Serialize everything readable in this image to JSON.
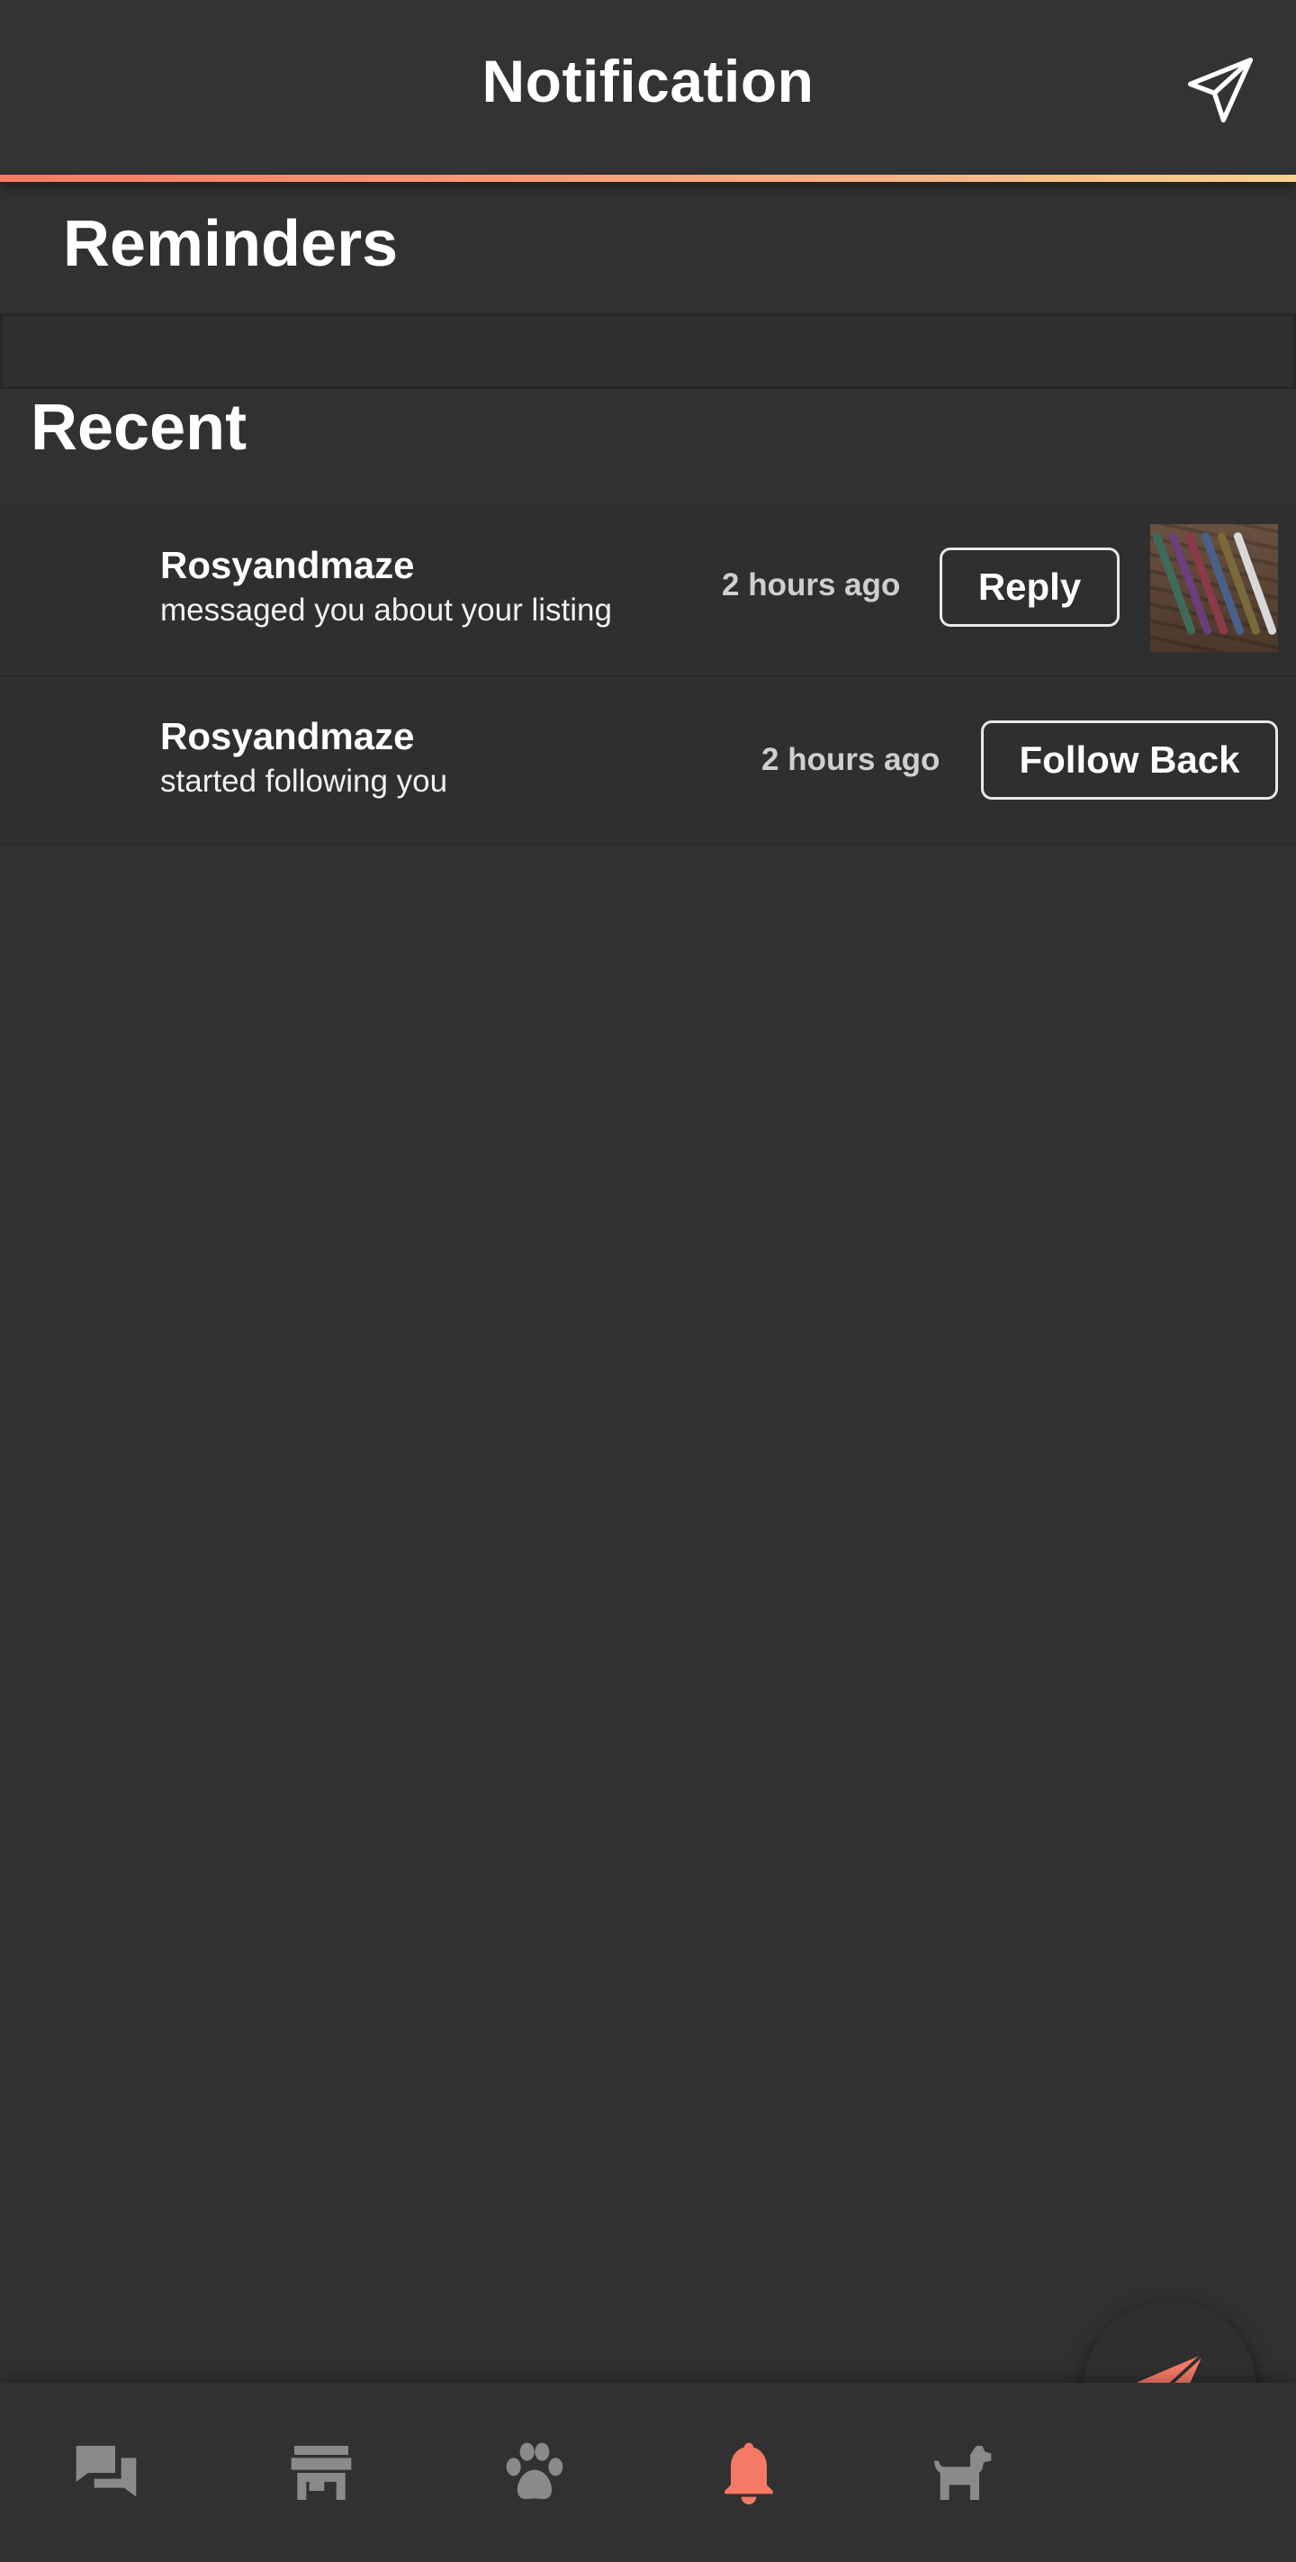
{
  "header": {
    "title": "Notification",
    "send_icon": "paper-plane-icon"
  },
  "reminders": {
    "title": "Reminders"
  },
  "recent": {
    "title": "Recent",
    "items": [
      {
        "name": "Rosyandmaze",
        "message": "messaged you about your listing",
        "time": "2 hours ago",
        "action": "Reply"
      },
      {
        "name": "Rosyandmaze",
        "message": "started following you",
        "time": "2 hours ago",
        "action": "Follow Back"
      }
    ]
  },
  "bottom_nav": {
    "items": [
      {
        "icon": "chat-icon",
        "active": false
      },
      {
        "icon": "store-icon",
        "active": false
      },
      {
        "icon": "paw-icon",
        "active": false
      },
      {
        "icon": "bell-icon",
        "active": true
      },
      {
        "icon": "dog-icon",
        "active": false
      }
    ],
    "fab_icon": "paper-plane-icon"
  },
  "colors": {
    "background": "#313131",
    "accent": "#f47a66",
    "nav_inactive": "#8a8a8a",
    "text": "#ffffff"
  }
}
